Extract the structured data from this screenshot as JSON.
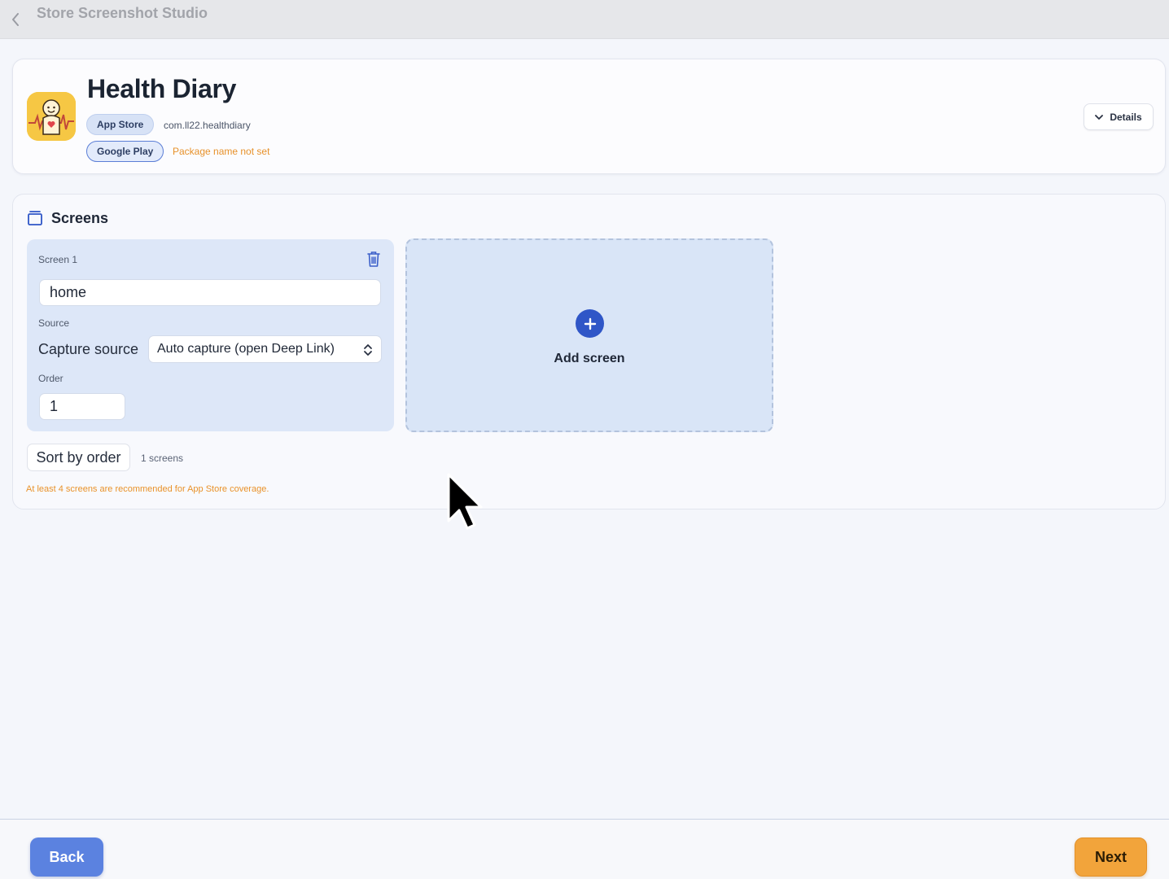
{
  "window": {
    "title": "Store Screenshot Studio"
  },
  "app": {
    "name": "Health Diary",
    "icon": "health-diary-app-icon",
    "app_store_badge": "App Store",
    "bundle_id": "com.ll22.healthdiary",
    "google_play_badge": "Google Play",
    "package_warning": "Package name not set",
    "details_label": "Details"
  },
  "screens": {
    "title": "Screens",
    "items": [
      {
        "label": "Screen 1",
        "name_value": "home",
        "source_label": "Source",
        "capture_label": "Capture source",
        "capture_value": "Auto capture (open Deep Link)",
        "order_label": "Order",
        "order_value": "1"
      }
    ],
    "add_label": "Add screen",
    "sort_label": "Sort by order",
    "count_text": "1 screens",
    "coverage_warning": "At least 4 screens are recommended for App Store coverage."
  },
  "footer": {
    "back_label": "Back",
    "next_label": "Next"
  },
  "colors": {
    "accent_blue": "#2f56c7",
    "back_button": "#5b82e0",
    "next_button": "#f2a43b",
    "warning": "#e7912a"
  }
}
